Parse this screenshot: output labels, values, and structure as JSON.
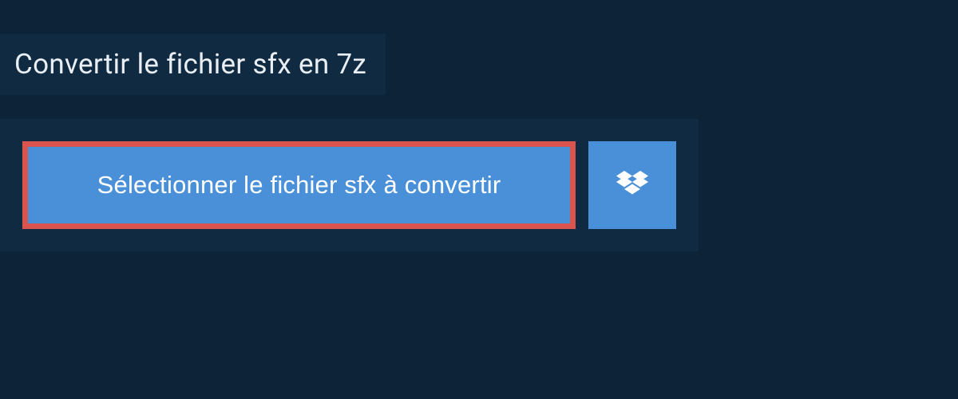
{
  "heading": {
    "title": "Convertir le fichier sfx en 7z"
  },
  "actions": {
    "select_file_label": "Sélectionner le fichier sfx à convertir"
  },
  "colors": {
    "page_bg": "#0d2438",
    "panel_bg": "#102a42",
    "button_bg": "#4a90d9",
    "highlight_border": "#d9534f",
    "text_light": "#e8eef3",
    "text_white": "#ffffff"
  }
}
